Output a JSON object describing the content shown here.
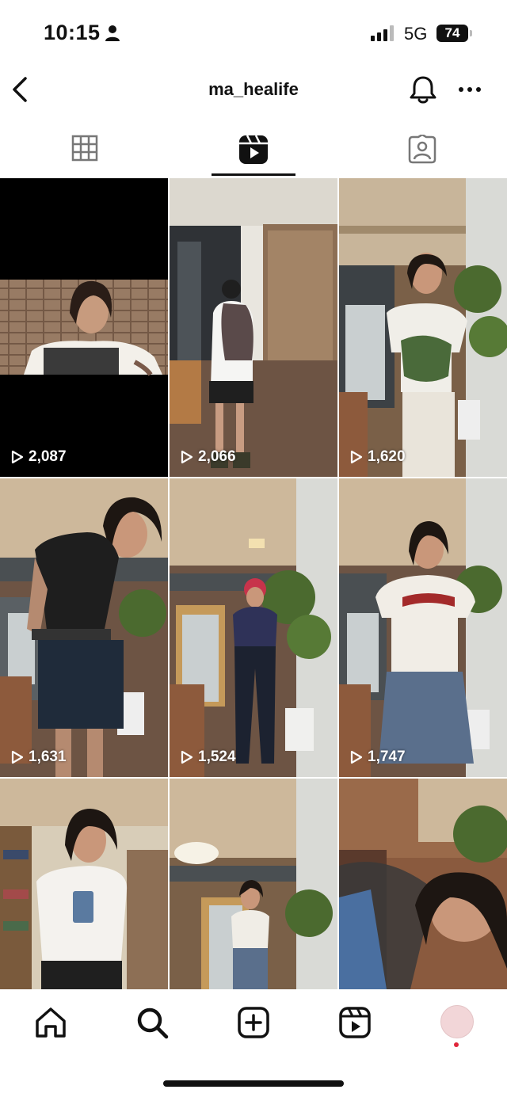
{
  "status_bar": {
    "time": "10:15",
    "network": "5G",
    "battery": "74"
  },
  "header": {
    "username": "ma_healife"
  },
  "tabs": [
    {
      "name": "grid",
      "icon": "grid-icon",
      "active": false
    },
    {
      "name": "reels",
      "icon": "reels-icon",
      "active": true
    },
    {
      "name": "tagged",
      "icon": "tagged-icon",
      "active": false
    }
  ],
  "reels": [
    {
      "views": "2,087"
    },
    {
      "views": "2,066"
    },
    {
      "views": "1,620"
    },
    {
      "views": "1,631"
    },
    {
      "views": "1,524"
    },
    {
      "views": "1,747"
    },
    {
      "views": ""
    },
    {
      "views": ""
    },
    {
      "views": ""
    }
  ],
  "bottom_nav": [
    {
      "icon": "home-icon"
    },
    {
      "icon": "search-icon"
    },
    {
      "icon": "create-icon"
    },
    {
      "icon": "reels-icon"
    },
    {
      "icon": "profile-avatar"
    }
  ],
  "colors": {
    "notification_dot": "#e0263a",
    "avatar_bg": "#f2d6d8"
  }
}
